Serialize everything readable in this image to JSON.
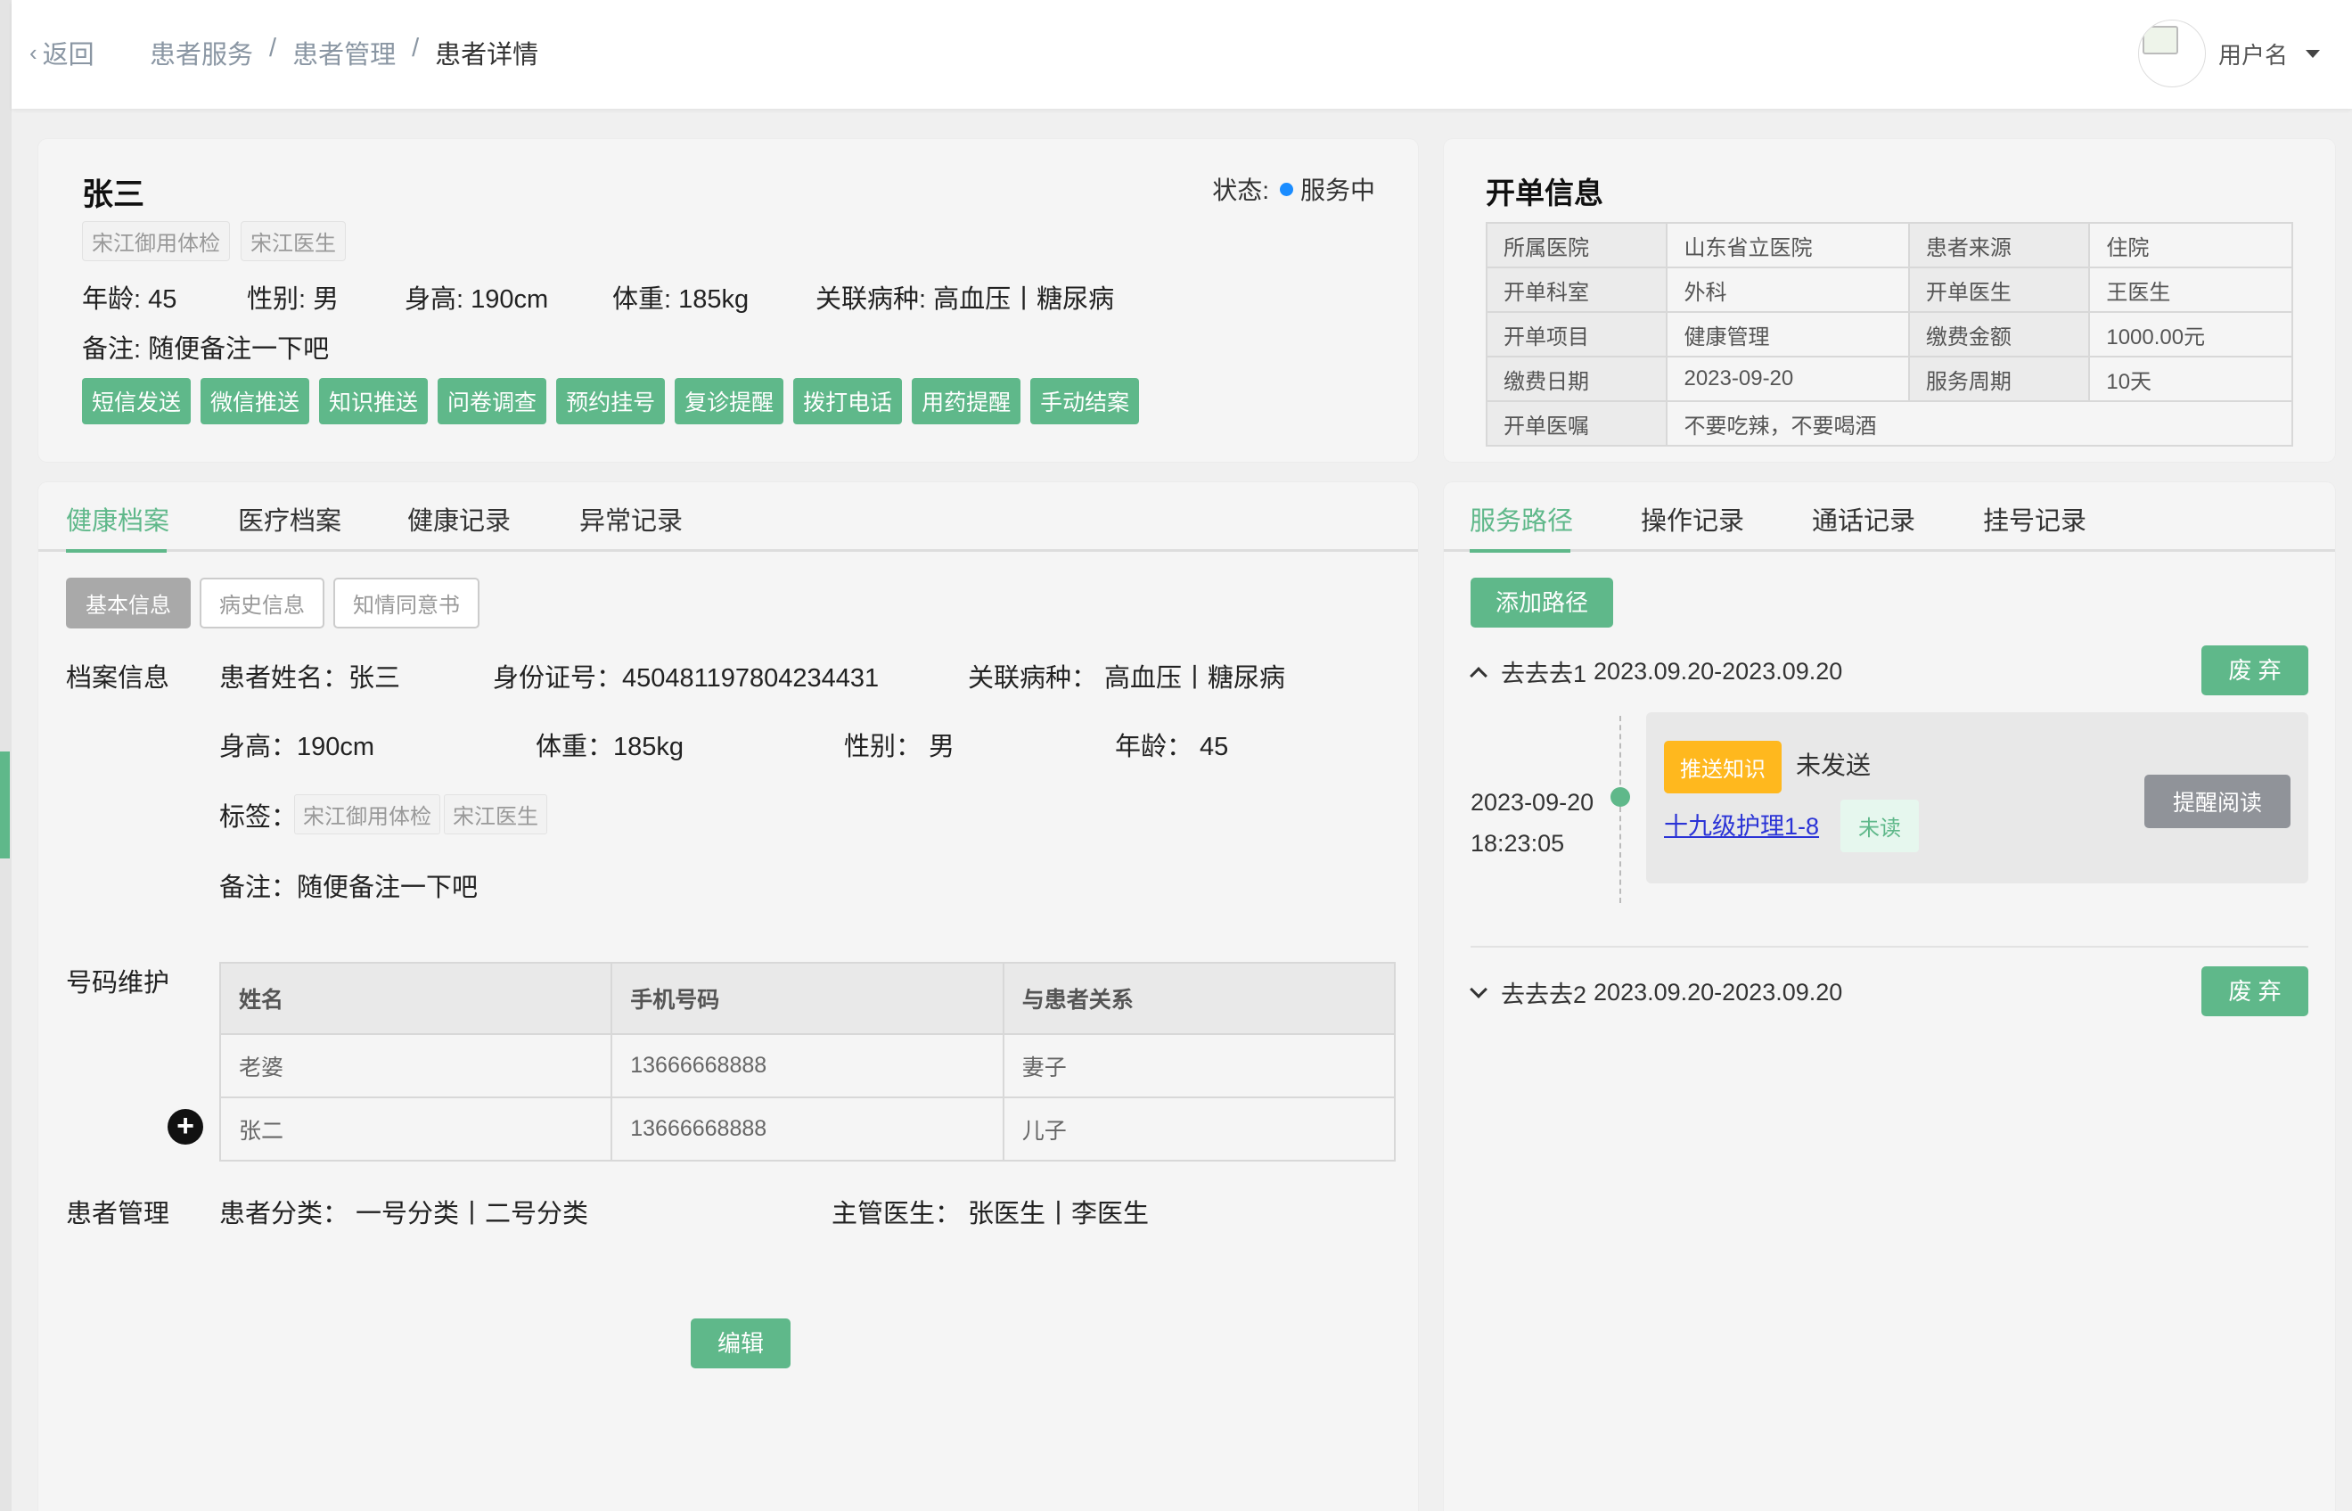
{
  "header": {
    "back_label": "返回",
    "breadcrumb": [
      "患者服务",
      "患者管理",
      "患者详情"
    ],
    "separator": "/",
    "username": "用户名"
  },
  "patient": {
    "name": "张三",
    "status_label": "状态:",
    "status_value": "服务中",
    "status_color": "#1a8cff",
    "tags": [
      "宋江御用体检",
      "宋江医生"
    ],
    "age": "年龄: 45",
    "gender": "性别: 男",
    "height": "身高: 190cm",
    "weight": "体重: 185kg",
    "diseases": "关联病种:  高血压丨糖尿病",
    "remark": "备注: 随便备注一下吧",
    "actions": [
      "短信发送",
      "微信推送",
      "知识推送",
      "问卷调查",
      "预约挂号",
      "复诊提醒",
      "拨打电话",
      "用药提醒",
      "手动结案"
    ]
  },
  "order": {
    "title": "开单信息",
    "rows": [
      [
        "所属医院",
        "山东省立医院",
        "患者来源",
        "住院"
      ],
      [
        "开单科室",
        "外科",
        "开单医生",
        "王医生"
      ],
      [
        "开单项目",
        "健康管理",
        "缴费金额",
        "1000.00元"
      ],
      [
        "缴费日期",
        "2023-09-20",
        "服务周期",
        "10天"
      ]
    ],
    "advice_label": "开单医嘱",
    "advice_value": "不要吃辣，不要喝酒"
  },
  "left_tabs": [
    "健康档案",
    "医疗档案",
    "健康记录",
    "异常记录"
  ],
  "sub_tabs": [
    "基本信息",
    "病史信息",
    "知情同意书"
  ],
  "archive": {
    "section_label": "档案信息",
    "name": "患者姓名：张三",
    "id_no": "身份证号：450481197804234431",
    "diseases": "关联病种：   高血压丨糖尿病",
    "height": "身高：190cm",
    "weight": "体重：185kg",
    "gender": "性别：  男",
    "age": "年龄：  45",
    "tags_label": "标签：",
    "tags": [
      "宋江御用体检",
      "宋江医生"
    ],
    "remark": "备注：随便备注一下吧"
  },
  "phones": {
    "section_label": "号码维护",
    "headers": [
      "姓名",
      "手机号码",
      "与患者关系"
    ],
    "rows": [
      [
        "老婆",
        "13666668888",
        "妻子"
      ],
      [
        "张二",
        "13666668888",
        "儿子"
      ]
    ]
  },
  "management": {
    "section_label": "患者管理",
    "category": "患者分类：   一号分类丨二号分类",
    "doctor": "主管医生：   张医生丨李医生"
  },
  "edit_label": "编辑",
  "right_tabs": [
    "服务路径",
    "操作记录",
    "通话记录",
    "挂号记录"
  ],
  "route": {
    "add_label": "添加路径",
    "discard_label": "废 弃",
    "routes": [
      {
        "name": "去去去1",
        "period": "2023.09.20-2023.09.20"
      },
      {
        "name": "去去去2",
        "period": "2023.09.20-2023.09.20"
      }
    ],
    "event": {
      "date": "2023-09-20",
      "time": "18:23:05",
      "tag": "推送知识",
      "send_status": "未发送",
      "link": "十九级护理1-8",
      "read_status": "未读",
      "remind_label": "提醒阅读"
    }
  },
  "colors": {
    "accent": "#5fb88a",
    "warning": "#ffb81e",
    "link": "#2a33d6"
  }
}
